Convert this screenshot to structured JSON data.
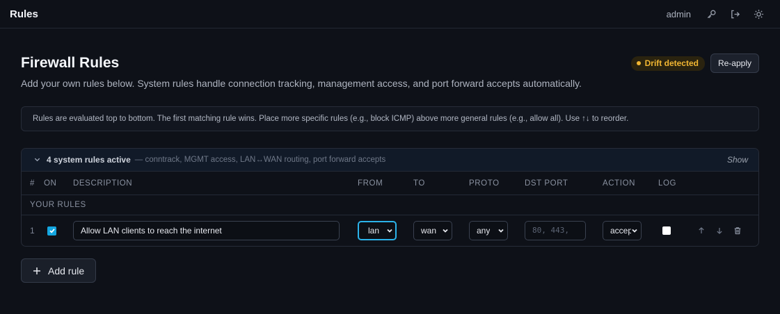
{
  "topbar": {
    "title": "Rules",
    "user": "admin",
    "icons": [
      "key-icon",
      "logout-icon",
      "theme-sun-icon"
    ]
  },
  "header": {
    "title": "Firewall Rules",
    "subtitle": "Add your own rules below. System rules handle connection tracking, management access, and port forward accepts automatically.",
    "drift_badge": "Drift detected",
    "reapply_label": "Re-apply"
  },
  "info": {
    "text": "Rules are evaluated top to bottom. The first matching rule wins. Place more specific rules (e.g., block ICMP) above more general rules (e.g., allow all). Use ↑↓ to reorder."
  },
  "system_rules": {
    "count_label": "4 system rules active",
    "description": "— conntrack, MGMT access, LAN↔WAN routing, port forward accepts",
    "toggle_label": "Show"
  },
  "table": {
    "columns": [
      "#",
      "ON",
      "DESCRIPTION",
      "FROM",
      "TO",
      "PROTO",
      "DST PORT",
      "ACTION",
      "LOG"
    ],
    "section_label": "YOUR RULES",
    "rows": [
      {
        "index": "1",
        "enabled": true,
        "description": "Allow LAN clients to reach the internet",
        "from": "lan",
        "to": "wan",
        "proto": "any",
        "dst_port_placeholder": "80, 443,",
        "action": "accept",
        "log": false
      }
    ]
  },
  "add_rule_label": "Add rule",
  "colors": {
    "background": "#0e1118",
    "accent": "#14a6e0",
    "warning": "#f2b632"
  }
}
